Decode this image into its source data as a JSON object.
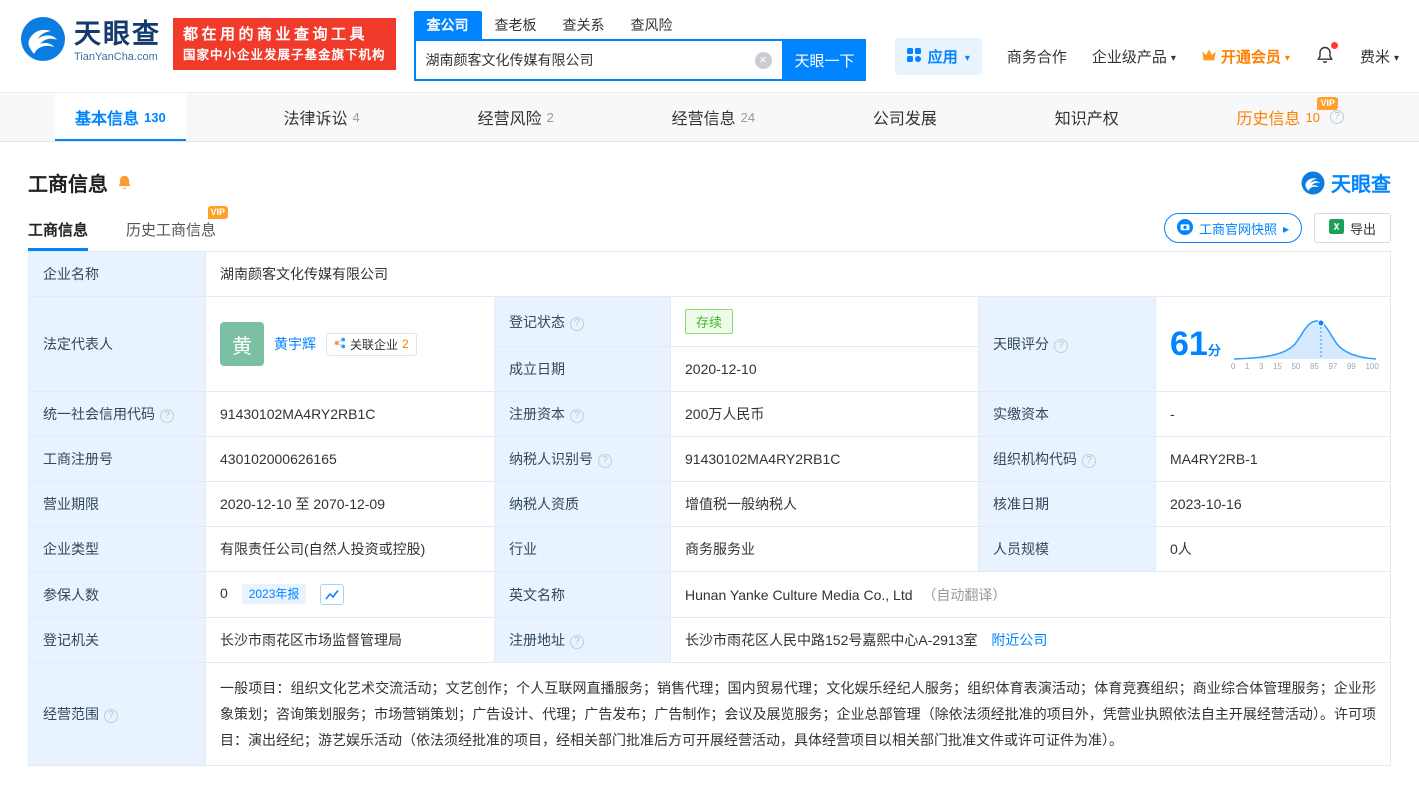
{
  "header": {
    "logo": {
      "brand": "天眼查",
      "domain": "TianYanCha.com"
    },
    "promo": {
      "line1": "都在用的商业查询工具",
      "line2": "国家中小企业发展子基金旗下机构"
    },
    "search": {
      "tabs": [
        {
          "label": "查公司"
        },
        {
          "label": "查老板"
        },
        {
          "label": "查关系"
        },
        {
          "label": "查风险"
        }
      ],
      "value": "湖南颜客文化传媒有限公司",
      "button": "天眼一下"
    },
    "menu": {
      "apps": "应用",
      "cooperation": "商务合作",
      "enterprise": "企业级产品",
      "vip": "开通会员",
      "user": "费米"
    }
  },
  "nav": {
    "vip_label": "VIP",
    "tabs": [
      {
        "label": "基本信息",
        "count": "130"
      },
      {
        "label": "法律诉讼",
        "count": "4"
      },
      {
        "label": "经营风险",
        "count": "2"
      },
      {
        "label": "经营信息",
        "count": "24"
      },
      {
        "label": "公司发展"
      },
      {
        "label": "知识产权"
      },
      {
        "label": "历史信息",
        "count": "10"
      }
    ]
  },
  "section": {
    "title": "工商信息",
    "logo_text": "天眼查",
    "vip_label": "VIP",
    "subtabs": [
      {
        "label": "工商信息"
      },
      {
        "label": "历史工商信息"
      }
    ],
    "snapshot_button": "工商官网快照",
    "export_button": "导出"
  },
  "table": {
    "company_name": {
      "label": "企业名称",
      "value": "湖南颜客文化传媒有限公司"
    },
    "legal_rep": {
      "label": "法定代表人",
      "avatar": "黄",
      "name": "黄宇辉",
      "related_label": "关联企业",
      "related_count": "2"
    },
    "reg_status": {
      "label": "登记状态",
      "value": "存续"
    },
    "establish_date": {
      "label": "成立日期",
      "value": "2020-12-10"
    },
    "score": {
      "label": "天眼评分",
      "value": "61",
      "unit": "分",
      "axis_ticks": [
        "0",
        "1",
        "3",
        "15",
        "50",
        "85",
        "97",
        "99",
        "100"
      ]
    },
    "credit_code": {
      "label": "统一社会信用代码",
      "value": "91430102MA4RY2RB1C"
    },
    "reg_capital": {
      "label": "注册资本",
      "value": "200万人民币"
    },
    "paid_capital": {
      "label": "实缴资本",
      "value": "-"
    },
    "reg_number": {
      "label": "工商注册号",
      "value": "430102000626165"
    },
    "taxpayer_id": {
      "label": "纳税人识别号",
      "value": "91430102MA4RY2RB1C"
    },
    "org_code": {
      "label": "组织机构代码",
      "value": "MA4RY2RB-1"
    },
    "business_term": {
      "label": "营业期限",
      "value": "2020-12-10 至 2070-12-09"
    },
    "taxpayer_quality": {
      "label": "纳税人资质",
      "value": "增值税一般纳税人"
    },
    "approval_date": {
      "label": "核准日期",
      "value": "2023-10-16"
    },
    "company_type": {
      "label": "企业类型",
      "value": "有限责任公司(自然人投资或控股)"
    },
    "industry": {
      "label": "行业",
      "value": "商务服务业"
    },
    "staff_size": {
      "label": "人员规模",
      "value": "0人"
    },
    "insured": {
      "label": "参保人数",
      "value": "0",
      "badge": "2023年报"
    },
    "english_name": {
      "label": "英文名称",
      "value": "Hunan Yanke Culture Media Co., Ltd",
      "note": "（自动翻译）"
    },
    "reg_authority": {
      "label": "登记机关",
      "value": "长沙市雨花区市场监督管理局"
    },
    "address": {
      "label": "注册地址",
      "value": "长沙市雨花区人民中路152号嘉熙中心A-2913室",
      "link": "附近公司"
    },
    "business_scope": {
      "label": "经营范围",
      "value": "一般项目：组织文化艺术交流活动；文艺创作；个人互联网直播服务；销售代理；国内贸易代理；文化娱乐经纪人服务；组织体育表演活动；体育竞赛组织；商业综合体管理服务；企业形象策划；咨询策划服务；市场营销策划；广告设计、代理；广告发布；广告制作；会议及展览服务；企业总部管理（除依法须经批准的项目外，凭营业执照依法自主开展经营活动）。许可项目：演出经纪；游艺娱乐活动（依法须经批准的项目，经相关部门批准后方可开展经营活动，具体经营项目以相关部门批准文件或许可证件为准）。"
    }
  }
}
